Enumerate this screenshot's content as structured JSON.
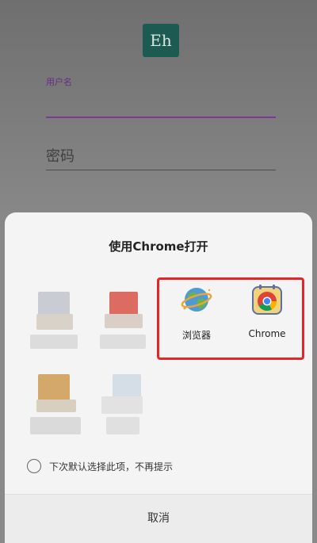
{
  "app": {
    "logo_text": "Eh"
  },
  "login": {
    "username_label": "用户名",
    "password_placeholder": "密码"
  },
  "chooser": {
    "title": "使用Chrome打开",
    "apps": [
      {
        "label": "浏览器",
        "icon": "browser-globe-icon"
      },
      {
        "label": "Chrome",
        "icon": "chrome-icon"
      }
    ],
    "remember_text": "下次默认选择此项，不再提示",
    "cancel_label": "取消",
    "highlight_color": "#e2262b"
  }
}
